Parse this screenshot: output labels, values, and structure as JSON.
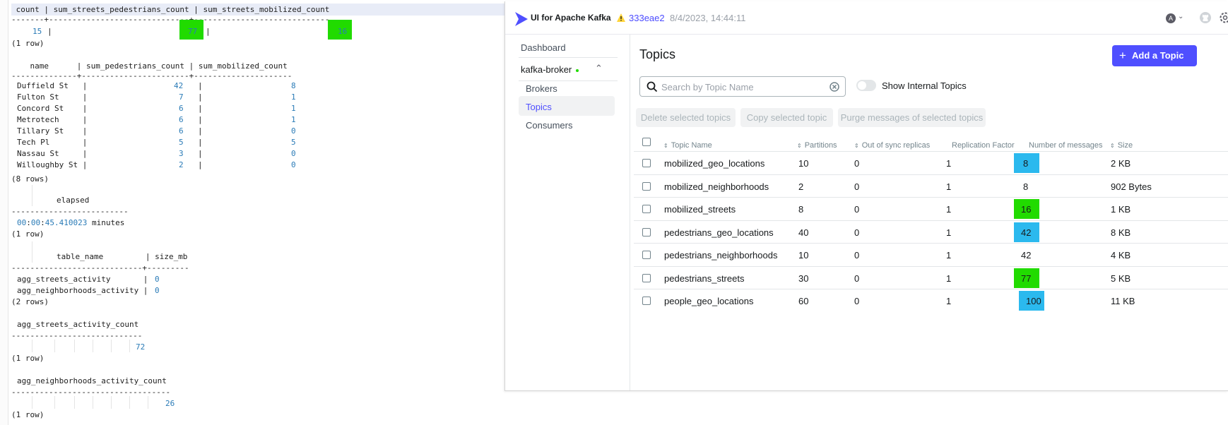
{
  "terminal": {
    "q1_header": " count | sum_streets_pedestrians_count | sum_streets_mobilized_count",
    "q1_sep": "-------+------------------------------+-----------------------------",
    "q1_count": "15",
    "q1_ped": "77",
    "q1_mob": "16",
    "q1_footer": "(1 row)",
    "q2_header": "    name      | sum_pedestrians_count | sum_mobilized_count",
    "q2_sep": "--------------+-----------------------+---------------------",
    "q2_rows": [
      {
        "name": "Duffield St   ",
        "ped": "42",
        "mob": "8"
      },
      {
        "name": "Fulton St     ",
        "ped": "7",
        "mob": "1"
      },
      {
        "name": "Concord St    ",
        "ped": "6",
        "mob": "1"
      },
      {
        "name": "Metrotech     ",
        "ped": "6",
        "mob": "1"
      },
      {
        "name": "Tillary St    ",
        "ped": "6",
        "mob": "0"
      },
      {
        "name": "Tech Pl       ",
        "ped": "5",
        "mob": "5"
      },
      {
        "name": "Nassau St     ",
        "ped": "3",
        "mob": "0"
      },
      {
        "name": "Willoughby St ",
        "ped": "2",
        "mob": "0"
      }
    ],
    "q2_footer": "(8 rows)",
    "q3_header": "elapsed",
    "q3_sep": "-------------------------",
    "q3_value_h": "00",
    "q3_value_m": "00",
    "q3_value_s": "45.410023",
    "q3_value_unit": " minutes",
    "q3_footer": "(1 row)",
    "q4_header": "table_name         | size_mb",
    "q4_sep": "----------------------------+---------",
    "q4_rows": [
      {
        "name": "agg_streets_activity       ",
        "size": "0"
      },
      {
        "name": "agg_neighborhoods_activity ",
        "size": "0"
      }
    ],
    "q4_footer": "(2 rows)",
    "q5_header": "agg_streets_activity_count",
    "q5_sep": "----------------------------",
    "q5_value": "72",
    "q5_footer": "(1 row)",
    "q6_header": "agg_neighborhoods_activity_count",
    "q6_sep": "----------------------------------",
    "q6_value": "26",
    "q6_footer": "(1 row)"
  },
  "kafka": {
    "brand": "UI for Apache Kafka",
    "version": "333eae2",
    "version_date": "8/4/2023, 14:44:11",
    "avatar_letter": "A",
    "sidebar": {
      "dashboard": "Dashboard",
      "cluster": "kafka-broker",
      "brokers": "Brokers",
      "topics": "Topics",
      "consumers": "Consumers"
    },
    "title": "Topics",
    "add_button": "Add a Topic",
    "search_placeholder": "Search by Topic Name",
    "toggle_label": "Show Internal Topics",
    "bulk": {
      "delete": "Delete selected topics",
      "copy": "Copy selected topic",
      "purge": "Purge messages of selected topics"
    },
    "columns": {
      "name": "Topic Name",
      "partitions": "Partitions",
      "out_of_sync": "Out of sync replicas",
      "replication": "Replication Factor",
      "messages": "Number of messages",
      "size": "Size"
    },
    "rows": [
      {
        "name": "mobilized_geo_locations",
        "partitions": "10",
        "oos": "0",
        "rf": "1",
        "messages": "8",
        "size": "2 KB",
        "highlight": "blue"
      },
      {
        "name": "mobilized_neighborhoods",
        "partitions": "2",
        "oos": "0",
        "rf": "1",
        "messages": "8",
        "size": "902 Bytes",
        "highlight": "none"
      },
      {
        "name": "mobilized_streets",
        "partitions": "8",
        "oos": "0",
        "rf": "1",
        "messages": "16",
        "size": "1 KB",
        "highlight": "green"
      },
      {
        "name": "pedestrians_geo_locations",
        "partitions": "40",
        "oos": "0",
        "rf": "1",
        "messages": "42",
        "size": "8 KB",
        "highlight": "blue"
      },
      {
        "name": "pedestrians_neighborhoods",
        "partitions": "10",
        "oos": "0",
        "rf": "1",
        "messages": "42",
        "size": "4 KB",
        "highlight": "none"
      },
      {
        "name": "pedestrians_streets",
        "partitions": "30",
        "oos": "0",
        "rf": "1",
        "messages": "77",
        "size": "5 KB",
        "highlight": "green"
      },
      {
        "name": "people_geo_locations",
        "partitions": "60",
        "oos": "0",
        "rf": "1",
        "messages": "100",
        "size": "11 KB",
        "highlight": "blue"
      }
    ]
  },
  "colors": {
    "highlight_green": "#21db00",
    "highlight_blue": "#2bb9ee",
    "accent": "#4f4fff"
  }
}
